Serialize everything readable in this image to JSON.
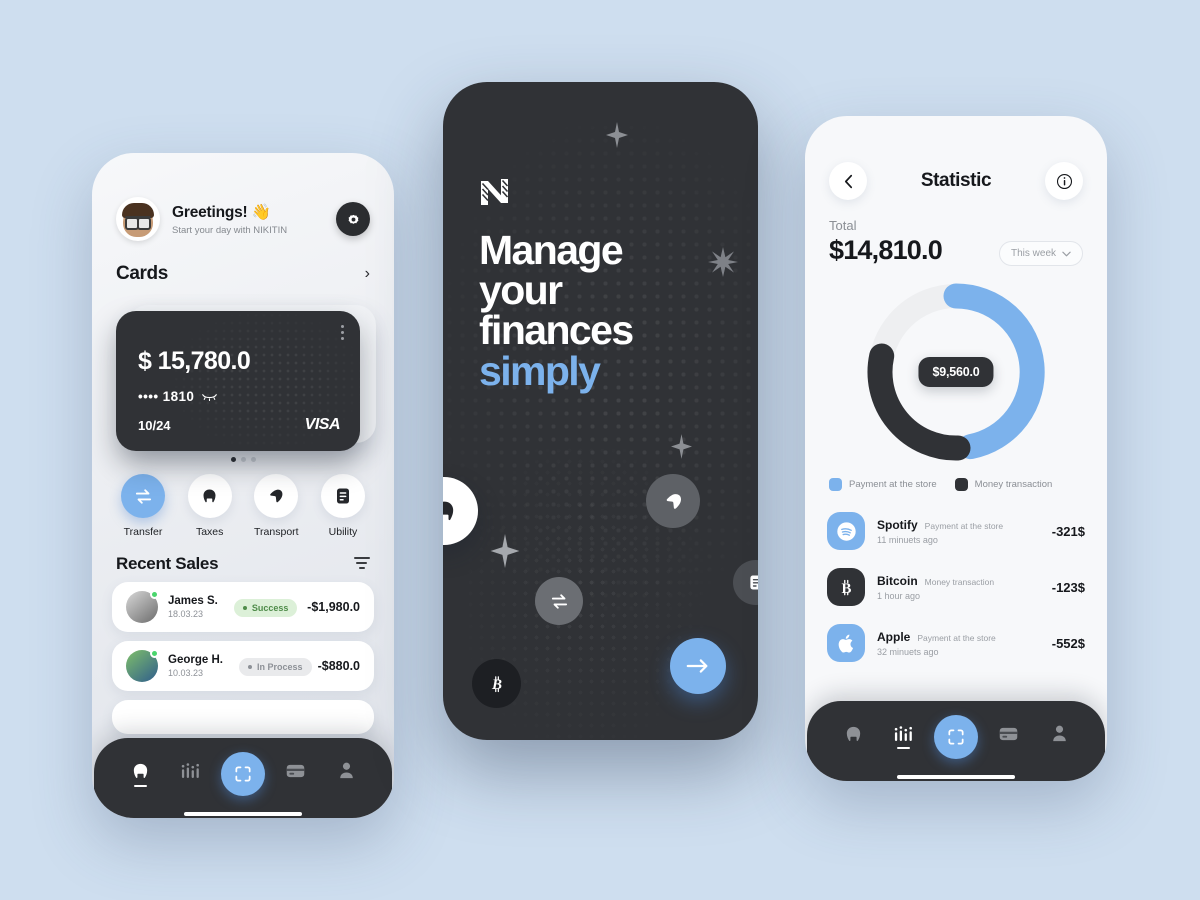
{
  "theme": {
    "page_bg": "#cedeef",
    "accent_blue": "#7cb2ec",
    "dark": "#303236",
    "success_bg": "#dcf0d8",
    "success_fg": "#4f8c4a",
    "pending_bg": "#e9eaec",
    "pending_fg": "#8d9197"
  },
  "phone1": {
    "greeting_title": "Greetings! 👋",
    "greeting_sub": "Start your day with NIKITIN",
    "settings_icon": "gear-icon",
    "cards_section": {
      "title": "Cards",
      "chevron": "›",
      "card": {
        "amount": "$ 15,780.0",
        "masked_number": "•••• 1810",
        "expiry": "10/24",
        "brand": "VISA",
        "menu_icon": "kebab-menu-icon"
      },
      "pager_dots": 3,
      "pager_active": 0
    },
    "actions": [
      {
        "label": "Transfer",
        "icon": "transfer-icon",
        "active": true
      },
      {
        "label": "Taxes",
        "icon": "house-icon",
        "active": false
      },
      {
        "label": "Transport",
        "icon": "transport-icon",
        "active": false
      },
      {
        "label": "Ubility",
        "icon": "document-icon",
        "active": false
      }
    ],
    "recent": {
      "title": "Recent Sales",
      "filter_icon": "filter-icon",
      "rows": [
        {
          "name": "James S.",
          "date": "18.03.23",
          "status": "Success",
          "status_type": "success",
          "amount": "-$1,980.0"
        },
        {
          "name": "George H.",
          "date": "10.03.23",
          "status": "In Process",
          "status_type": "pending",
          "amount": "-$880.0"
        }
      ]
    },
    "nav": [
      {
        "icon": "home-icon",
        "active": true
      },
      {
        "icon": "stats-icon",
        "active": false
      },
      {
        "icon": "scan-icon",
        "active": false,
        "primary": true
      },
      {
        "icon": "card-icon",
        "active": false
      },
      {
        "icon": "profile-icon",
        "active": false
      }
    ]
  },
  "phone2": {
    "logo": "n-logo-icon",
    "headline_lines": [
      "Manage",
      "your",
      "finances"
    ],
    "headline_accent": "simply",
    "floating": [
      {
        "icon": "house-icon",
        "name": "floating-house-bubble"
      },
      {
        "icon": "transport-icon",
        "name": "floating-transport-bubble"
      },
      {
        "icon": "transfer-icon",
        "name": "floating-transfer-bubble"
      },
      {
        "icon": "document-icon",
        "name": "floating-document-bubble"
      },
      {
        "icon": "bitcoin-icon",
        "name": "floating-bitcoin-bubble"
      },
      {
        "icon": "arrow-right-icon",
        "name": "get-started-button"
      }
    ]
  },
  "phone3": {
    "back_icon": "chevron-left-icon",
    "title": "Statistic",
    "info_icon": "info-icon",
    "total_label": "Total",
    "total_value": "$14,810.0",
    "period": "This week",
    "period_chevron": "chevron-down-icon",
    "center_value": "$9,560.0",
    "legend": [
      {
        "label": "Payment at the store",
        "color": "#7cb2ec"
      },
      {
        "label": "Money transaction",
        "color": "#303236"
      }
    ],
    "transactions": [
      {
        "name": "Spotify",
        "category": "Payment at the store",
        "time": "11 minuets ago",
        "amount": "-321$",
        "icon": "spotify-icon",
        "icon_bg": "#7cb2ec"
      },
      {
        "name": "Bitcoin",
        "category": "Money transaction",
        "time": "1 hour ago",
        "amount": "-123$",
        "icon": "bitcoin-icon",
        "icon_bg": "#303236"
      },
      {
        "name": "Apple",
        "category": "Payment at the store",
        "time": "32 minuets ago",
        "amount": "-552$",
        "icon": "apple-icon",
        "icon_bg": "#7cb2ec"
      }
    ],
    "nav": [
      {
        "icon": "home-icon",
        "active": false
      },
      {
        "icon": "stats-icon",
        "active": true
      },
      {
        "icon": "scan-icon",
        "active": false,
        "primary": true
      },
      {
        "icon": "card-icon",
        "active": false
      },
      {
        "icon": "profile-icon",
        "active": false
      }
    ]
  },
  "chart_data": {
    "type": "pie",
    "title": "Statistic",
    "center_label": "$9,560.0",
    "total": "$14,810.0",
    "categories": [
      "Payment at the store",
      "Money transaction",
      "Remaining"
    ],
    "values": [
      48,
      27,
      25
    ],
    "colors": [
      "#7cb2ec",
      "#303236",
      "#eeeff1"
    ],
    "legend_position": "bottom",
    "grid": false
  }
}
